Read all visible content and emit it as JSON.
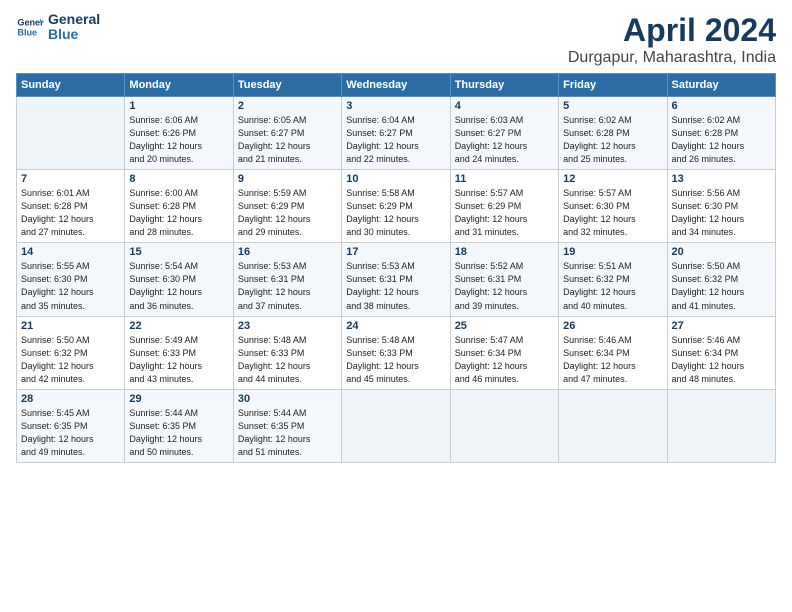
{
  "app": {
    "logo_line1": "General",
    "logo_line2": "Blue"
  },
  "header": {
    "title": "April 2024",
    "location": "Durgapur, Maharashtra, India"
  },
  "days_of_week": [
    "Sunday",
    "Monday",
    "Tuesday",
    "Wednesday",
    "Thursday",
    "Friday",
    "Saturday"
  ],
  "weeks": [
    [
      {
        "num": "",
        "info": ""
      },
      {
        "num": "1",
        "info": "Sunrise: 6:06 AM\nSunset: 6:26 PM\nDaylight: 12 hours\nand 20 minutes."
      },
      {
        "num": "2",
        "info": "Sunrise: 6:05 AM\nSunset: 6:27 PM\nDaylight: 12 hours\nand 21 minutes."
      },
      {
        "num": "3",
        "info": "Sunrise: 6:04 AM\nSunset: 6:27 PM\nDaylight: 12 hours\nand 22 minutes."
      },
      {
        "num": "4",
        "info": "Sunrise: 6:03 AM\nSunset: 6:27 PM\nDaylight: 12 hours\nand 24 minutes."
      },
      {
        "num": "5",
        "info": "Sunrise: 6:02 AM\nSunset: 6:28 PM\nDaylight: 12 hours\nand 25 minutes."
      },
      {
        "num": "6",
        "info": "Sunrise: 6:02 AM\nSunset: 6:28 PM\nDaylight: 12 hours\nand 26 minutes."
      }
    ],
    [
      {
        "num": "7",
        "info": "Sunrise: 6:01 AM\nSunset: 6:28 PM\nDaylight: 12 hours\nand 27 minutes."
      },
      {
        "num": "8",
        "info": "Sunrise: 6:00 AM\nSunset: 6:28 PM\nDaylight: 12 hours\nand 28 minutes."
      },
      {
        "num": "9",
        "info": "Sunrise: 5:59 AM\nSunset: 6:29 PM\nDaylight: 12 hours\nand 29 minutes."
      },
      {
        "num": "10",
        "info": "Sunrise: 5:58 AM\nSunset: 6:29 PM\nDaylight: 12 hours\nand 30 minutes."
      },
      {
        "num": "11",
        "info": "Sunrise: 5:57 AM\nSunset: 6:29 PM\nDaylight: 12 hours\nand 31 minutes."
      },
      {
        "num": "12",
        "info": "Sunrise: 5:57 AM\nSunset: 6:30 PM\nDaylight: 12 hours\nand 32 minutes."
      },
      {
        "num": "13",
        "info": "Sunrise: 5:56 AM\nSunset: 6:30 PM\nDaylight: 12 hours\nand 34 minutes."
      }
    ],
    [
      {
        "num": "14",
        "info": "Sunrise: 5:55 AM\nSunset: 6:30 PM\nDaylight: 12 hours\nand 35 minutes."
      },
      {
        "num": "15",
        "info": "Sunrise: 5:54 AM\nSunset: 6:30 PM\nDaylight: 12 hours\nand 36 minutes."
      },
      {
        "num": "16",
        "info": "Sunrise: 5:53 AM\nSunset: 6:31 PM\nDaylight: 12 hours\nand 37 minutes."
      },
      {
        "num": "17",
        "info": "Sunrise: 5:53 AM\nSunset: 6:31 PM\nDaylight: 12 hours\nand 38 minutes."
      },
      {
        "num": "18",
        "info": "Sunrise: 5:52 AM\nSunset: 6:31 PM\nDaylight: 12 hours\nand 39 minutes."
      },
      {
        "num": "19",
        "info": "Sunrise: 5:51 AM\nSunset: 6:32 PM\nDaylight: 12 hours\nand 40 minutes."
      },
      {
        "num": "20",
        "info": "Sunrise: 5:50 AM\nSunset: 6:32 PM\nDaylight: 12 hours\nand 41 minutes."
      }
    ],
    [
      {
        "num": "21",
        "info": "Sunrise: 5:50 AM\nSunset: 6:32 PM\nDaylight: 12 hours\nand 42 minutes."
      },
      {
        "num": "22",
        "info": "Sunrise: 5:49 AM\nSunset: 6:33 PM\nDaylight: 12 hours\nand 43 minutes."
      },
      {
        "num": "23",
        "info": "Sunrise: 5:48 AM\nSunset: 6:33 PM\nDaylight: 12 hours\nand 44 minutes."
      },
      {
        "num": "24",
        "info": "Sunrise: 5:48 AM\nSunset: 6:33 PM\nDaylight: 12 hours\nand 45 minutes."
      },
      {
        "num": "25",
        "info": "Sunrise: 5:47 AM\nSunset: 6:34 PM\nDaylight: 12 hours\nand 46 minutes."
      },
      {
        "num": "26",
        "info": "Sunrise: 5:46 AM\nSunset: 6:34 PM\nDaylight: 12 hours\nand 47 minutes."
      },
      {
        "num": "27",
        "info": "Sunrise: 5:46 AM\nSunset: 6:34 PM\nDaylight: 12 hours\nand 48 minutes."
      }
    ],
    [
      {
        "num": "28",
        "info": "Sunrise: 5:45 AM\nSunset: 6:35 PM\nDaylight: 12 hours\nand 49 minutes."
      },
      {
        "num": "29",
        "info": "Sunrise: 5:44 AM\nSunset: 6:35 PM\nDaylight: 12 hours\nand 50 minutes."
      },
      {
        "num": "30",
        "info": "Sunrise: 5:44 AM\nSunset: 6:35 PM\nDaylight: 12 hours\nand 51 minutes."
      },
      {
        "num": "",
        "info": ""
      },
      {
        "num": "",
        "info": ""
      },
      {
        "num": "",
        "info": ""
      },
      {
        "num": "",
        "info": ""
      }
    ]
  ]
}
